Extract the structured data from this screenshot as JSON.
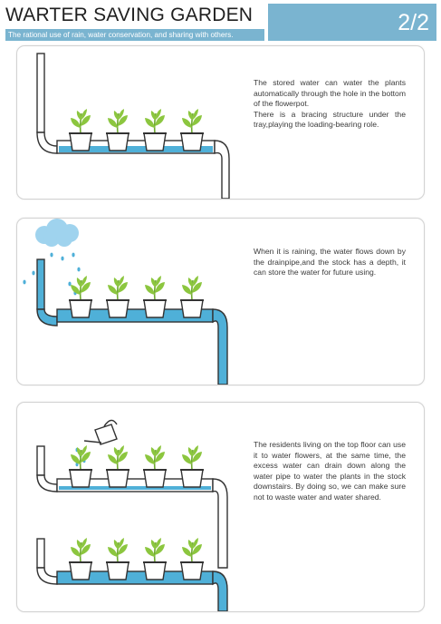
{
  "header": {
    "title": "WARTER SAVING GARDEN",
    "subtitle": "The rational use of rain, water conservation, and sharing with others.",
    "page": "2/2"
  },
  "panels": [
    {
      "scene": "tray-storage",
      "text": [
        "The stored water can water the plants automatically through the hole in the bottom of the flowerpot.",
        "There is a bracing structure under the tray,playing the loading-bearing role."
      ]
    },
    {
      "scene": "rain-collection",
      "text": "When it is raining, the water flows down by the drainpipe,and the stock has a depth, it can store the water for future using."
    },
    {
      "scene": "top-floor-watering",
      "text": "The residents living on the top floor can use it to water flowers, at the same time, the excess water can drain down along the water pipe to water the plants in the stock downstairs. By doing so, we can make sure not to waste water and water shared."
    }
  ],
  "icons": {
    "plant": "seedling-icon",
    "pot": "flowerpot-icon",
    "cloud": "rain-cloud-icon",
    "can": "watering-can-icon"
  },
  "colors": {
    "accent": "#7ab4d0",
    "water": "#4fb0d8",
    "leaf": "#8cc63f",
    "pipe_outline": "#333333"
  }
}
